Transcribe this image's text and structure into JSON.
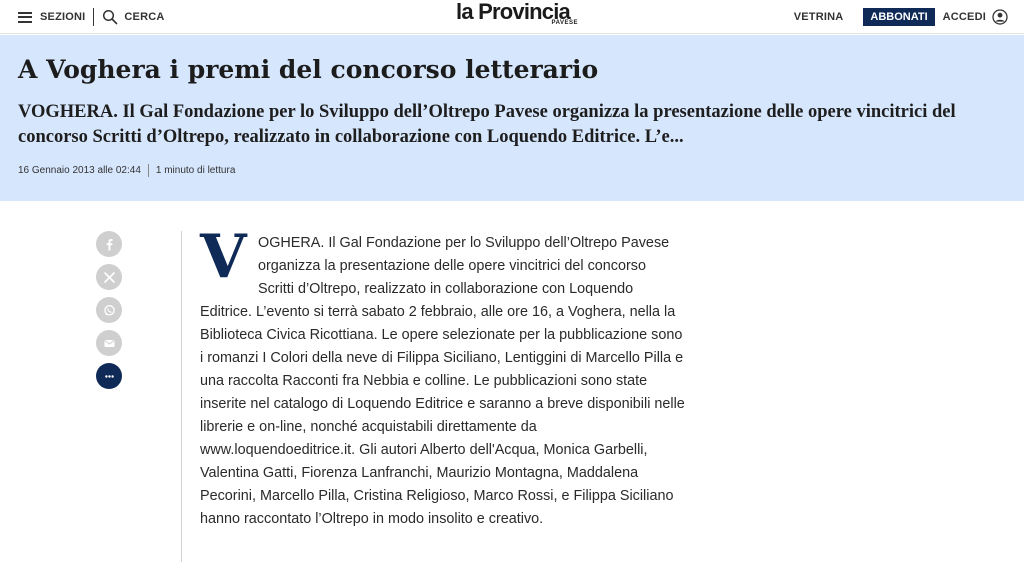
{
  "header": {
    "sections_label": "SEZIONI",
    "search_label": "CERCA",
    "logo_main": "la Provincia",
    "logo_sub": "PAVESE",
    "vetrina_label": "VETRINA",
    "subscribe_label": "ABBONATI",
    "login_label": "ACCEDI"
  },
  "article": {
    "title": "A Voghera i premi del concorso letterario",
    "summary": "VOGHERA. Il Gal Fondazione per lo Sviluppo dell’Oltrepo Pavese organizza la presentazione delle opere vincitrici del concorso Scritti d’Oltrepo, realizzato in collaborazione con Loquendo Editrice. L’e...",
    "date": "16 Gennaio 2013 alle 02:44",
    "reading_time": "1 minuto di lettura",
    "dropcap": "V",
    "body": "OGHERA. Il Gal Fondazione per lo Sviluppo dell’Oltrepo Pavese organizza la presentazione delle opere vincitrici del concorso Scritti d’Oltrepo, realizzato in collaborazione con Loquendo Editrice. L’evento si terrà sabato 2 febbraio, alle ore 16, a Voghera, nella la Biblioteca Civica Ricottiana. Le opere selezionate per la pubblicazione sono i romanzi I Colori della neve di Filippa Siciliano, Lentiggini di Marcello Pilla e una raccolta Racconti fra Nebbia e colline. Le pubblicazioni sono state inserite nel catalogo di Loquendo Editrice e saranno a breve disponibili nelle librerie e on-line, nonché acquistabili direttamente da www.loquendoeditrice.it. Gli autori Alberto dell'Acqua, Monica Garbelli, Valentina Gatti, Fiorenza Lanfranchi, Maurizio Montagna, Maddalena Pecorini, Marcello Pilla, Cristina Religioso, Marco Rossi, e Filippa Siciliano hanno raccontato l’Oltrepo in modo insolito e creativo."
  },
  "social": [
    {
      "name": "facebook-icon"
    },
    {
      "name": "x-icon"
    },
    {
      "name": "whatsapp-icon"
    },
    {
      "name": "email-icon"
    },
    {
      "name": "comments-icon"
    }
  ],
  "colors": {
    "hero_bg": "#d6e6fd",
    "brand_navy": "#0f2a57",
    "social_grey": "#cfcfcf"
  }
}
